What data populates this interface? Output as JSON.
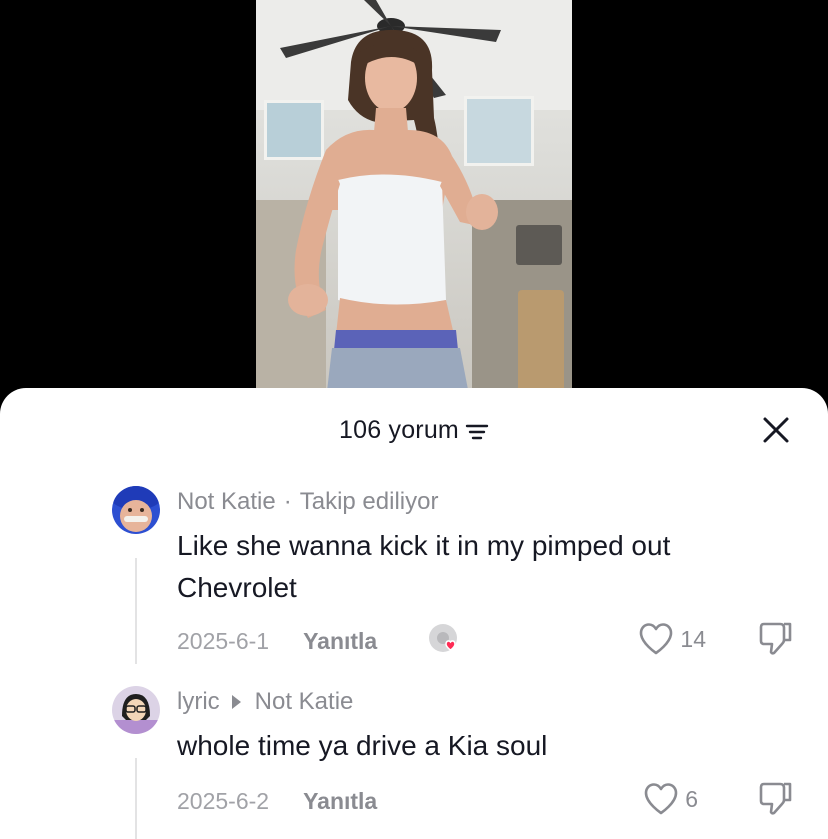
{
  "header": {
    "comment_count_label": "106 yorum"
  },
  "comments": [
    {
      "username": "Not Katie",
      "separator": "·",
      "status": "Takip ediliyor",
      "text": "Like she wanna kick it in my pimped out Chevrolet",
      "date": "2025-6-1",
      "reply_label": "Yanıtla",
      "likes": "14"
    },
    {
      "username": "lyric",
      "reply_to": "Not Katie",
      "text": "whole time ya drive a Kia soul",
      "date": "2025-6-2",
      "reply_label": "Yanıtla",
      "likes": "6"
    }
  ],
  "colors": {
    "accent_heart": "#fe2c55",
    "text_primary": "#161823",
    "text_secondary": "#8a8b91"
  }
}
